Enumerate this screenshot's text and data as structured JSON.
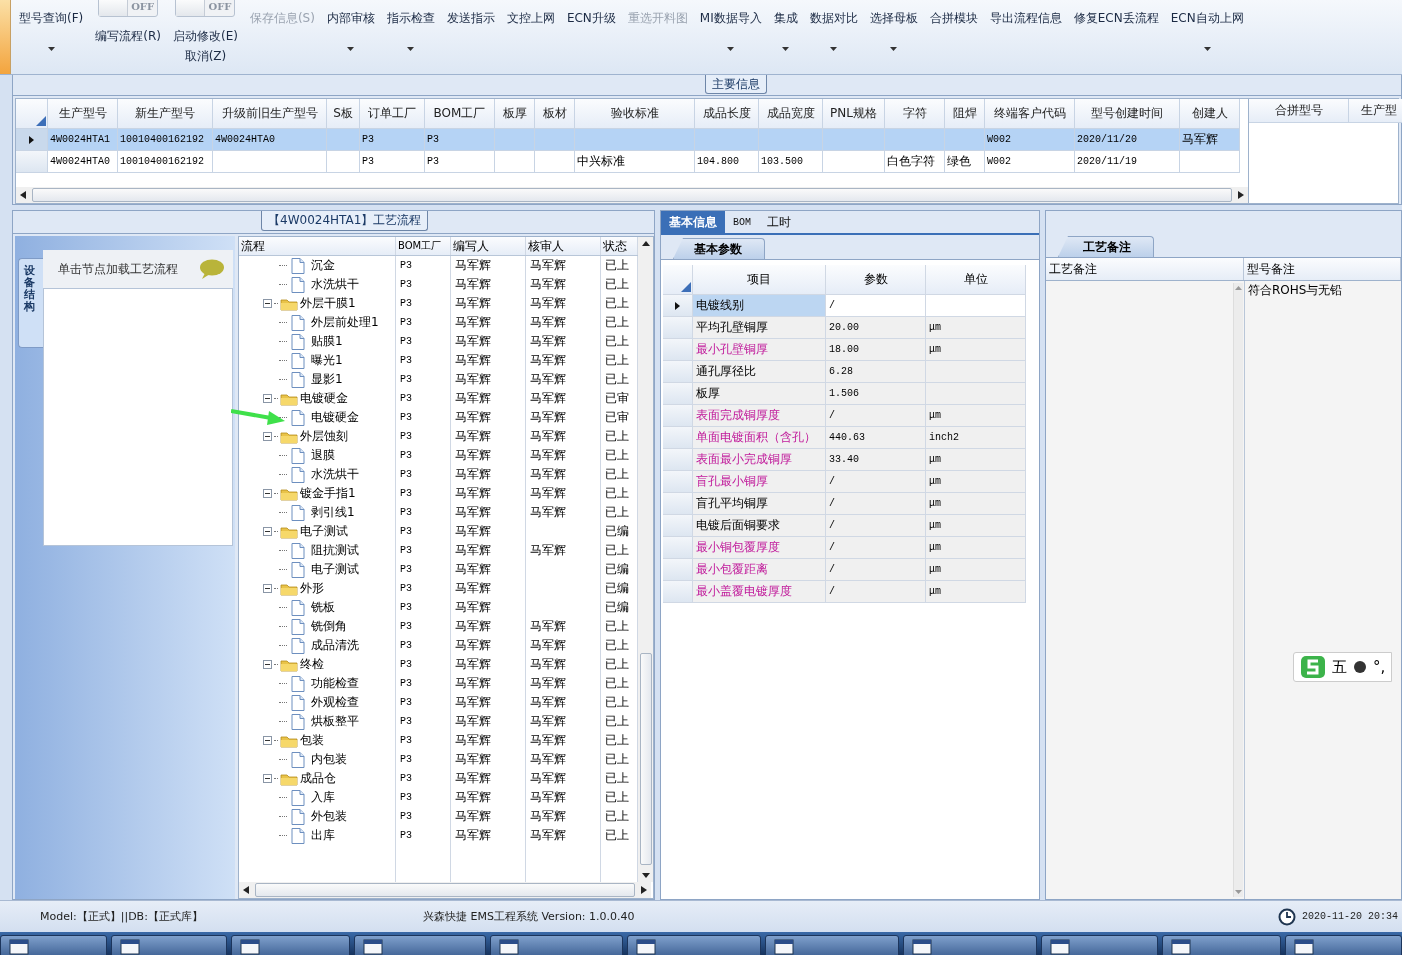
{
  "toolbar": {
    "items": [
      {
        "kind": "button",
        "label": "型号查询(F)",
        "dropdown": true,
        "disabled": false
      },
      {
        "kind": "toggle",
        "switch": "OFF",
        "on": false,
        "label": "编写流程(R)"
      },
      {
        "kind": "toggle",
        "switch": "OFF",
        "on": false,
        "label": "启动修改(E)",
        "sub": "取消(Z)"
      },
      {
        "kind": "button",
        "label": "保存信息(S)",
        "dropdown": false,
        "disabled": true
      },
      {
        "kind": "button",
        "label": "内部审核",
        "dropdown": true,
        "disabled": false
      },
      {
        "kind": "button",
        "label": "指示检查",
        "dropdown": true,
        "disabled": false
      },
      {
        "kind": "button",
        "label": "发送指示",
        "dropdown": false,
        "disabled": false
      },
      {
        "kind": "button",
        "label": "文控上网",
        "dropdown": false,
        "disabled": false
      },
      {
        "kind": "button",
        "label": "ECN升级",
        "dropdown": false,
        "disabled": false
      },
      {
        "kind": "button",
        "label": "重选开料图",
        "dropdown": false,
        "disabled": true
      },
      {
        "kind": "button",
        "label": "MI数据导入",
        "dropdown": true,
        "disabled": false
      },
      {
        "kind": "button",
        "label": "集成",
        "dropdown": true,
        "disabled": false
      },
      {
        "kind": "button",
        "label": "数据对比",
        "dropdown": true,
        "disabled": false
      },
      {
        "kind": "button",
        "label": "选择母板",
        "dropdown": true,
        "disabled": false
      },
      {
        "kind": "button",
        "label": "合拼模块",
        "dropdown": false,
        "disabled": false
      },
      {
        "kind": "button",
        "label": "导出流程信息",
        "dropdown": false,
        "disabled": false
      },
      {
        "kind": "button",
        "label": "修复ECN丢流程",
        "dropdown": false,
        "disabled": false
      },
      {
        "kind": "button",
        "label": "ECN自动上网",
        "dropdown": true,
        "disabled": false
      }
    ]
  },
  "main_info": {
    "title": "主要信息",
    "table": {
      "columns": [
        "生产型号",
        "新生产型号",
        "升级前旧生产型号",
        "S板",
        "订单工厂",
        "BOM工厂",
        "板厚",
        "板材",
        "验收标准",
        "成品长度",
        "成品宽度",
        "PNL规格",
        "字符",
        "阻焊",
        "终端客户代码",
        "型号创建时间",
        "创建人"
      ],
      "rows": [
        {
          "selected": true,
          "cells": [
            "4W0024HTA1",
            "10010400162192",
            "4W0024HTA0",
            null,
            "P3",
            "P3",
            null,
            null,
            null,
            null,
            null,
            null,
            null,
            null,
            "W002",
            "2020/11/20",
            "马军辉"
          ]
        },
        {
          "selected": false,
          "cells": [
            "4W0024HTA0",
            "10010400162192",
            null,
            null,
            "P3",
            "P3",
            null,
            null,
            "中兴标准",
            "104.800",
            "103.500",
            null,
            "白色字符",
            "绿色",
            "W002",
            "2020/11/19",
            null
          ]
        }
      ]
    },
    "side_table": {
      "columns": [
        "合拼型号",
        "生产型"
      ]
    }
  },
  "flow_panel": {
    "title": "【4W0024HTA1】工艺流程",
    "side_tab": "设备结构",
    "hint": "单击节点加载工艺流程",
    "tree": {
      "columns": [
        "流程",
        "BOM工厂",
        "编写人",
        "核审人",
        "状态"
      ],
      "nodes": [
        {
          "kind": "leaf",
          "cells": [
            "沉金",
            "P3",
            "马军辉",
            "马军辉",
            "已上"
          ]
        },
        {
          "kind": "leaf",
          "cells": [
            "水洗烘干",
            "P3",
            "马军辉",
            "马军辉",
            "已上"
          ]
        },
        {
          "kind": "folder",
          "expanded": true,
          "cells": [
            "外层干膜1",
            "P3",
            "马军辉",
            "马军辉",
            "已上"
          ],
          "children": [
            {
              "kind": "leaf",
              "cells": [
                "外层前处理1",
                "P3",
                "马军辉",
                "马军辉",
                "已上"
              ]
            },
            {
              "kind": "leaf",
              "cells": [
                "贴膜1",
                "P3",
                "马军辉",
                "马军辉",
                "已上"
              ]
            },
            {
              "kind": "leaf",
              "cells": [
                "曝光1",
                "P3",
                "马军辉",
                "马军辉",
                "已上"
              ]
            },
            {
              "kind": "leaf",
              "cells": [
                "显影1",
                "P3",
                "马军辉",
                "马军辉",
                "已上"
              ]
            }
          ]
        },
        {
          "kind": "folder",
          "expanded": true,
          "cells": [
            "电镀硬金",
            "P3",
            "马军辉",
            "马军辉",
            "已审"
          ],
          "children": [
            {
              "kind": "leaf",
              "cells": [
                "电镀硬金",
                "P3",
                "马军辉",
                "马军辉",
                "已审"
              ]
            }
          ]
        },
        {
          "kind": "folder",
          "expanded": true,
          "cells": [
            "外层蚀刻",
            "P3",
            "马军辉",
            "马军辉",
            "已上"
          ],
          "children": [
            {
              "kind": "leaf",
              "cells": [
                "退膜",
                "P3",
                "马军辉",
                "马军辉",
                "已上"
              ]
            },
            {
              "kind": "leaf",
              "cells": [
                "水洗烘干",
                "P3",
                "马军辉",
                "马军辉",
                "已上"
              ]
            }
          ]
        },
        {
          "kind": "folder",
          "expanded": true,
          "cells": [
            "镀金手指1",
            "P3",
            "马军辉",
            "马军辉",
            "已上"
          ],
          "children": [
            {
              "kind": "leaf",
              "cells": [
                "剥引线1",
                "P3",
                "马军辉",
                "马军辉",
                "已上"
              ]
            }
          ]
        },
        {
          "kind": "folder",
          "expanded": true,
          "cells": [
            "电子测试",
            "P3",
            "马军辉",
            null,
            "已编"
          ],
          "children": [
            {
              "kind": "leaf",
              "cells": [
                "阻抗测试",
                "P3",
                "马军辉",
                "马军辉",
                "已上"
              ]
            },
            {
              "kind": "leaf",
              "cells": [
                "电子测试",
                "P3",
                "马军辉",
                null,
                "已编"
              ]
            }
          ]
        },
        {
          "kind": "folder",
          "expanded": true,
          "cells": [
            "外形",
            "P3",
            "马军辉",
            null,
            "已编"
          ],
          "children": [
            {
              "kind": "leaf",
              "cells": [
                "铣板",
                "P3",
                "马军辉",
                null,
                "已编"
              ]
            },
            {
              "kind": "leaf",
              "cells": [
                "铣倒角",
                "P3",
                "马军辉",
                "马军辉",
                "已上"
              ]
            },
            {
              "kind": "leaf",
              "cells": [
                "成品清洗",
                "P3",
                "马军辉",
                "马军辉",
                "已上"
              ]
            }
          ]
        },
        {
          "kind": "folder",
          "expanded": true,
          "cells": [
            "终检",
            "P3",
            "马军辉",
            "马军辉",
            "已上"
          ],
          "children": [
            {
              "kind": "leaf",
              "cells": [
                "功能检查",
                "P3",
                "马军辉",
                "马军辉",
                "已上"
              ]
            },
            {
              "kind": "leaf",
              "cells": [
                "外观检查",
                "P3",
                "马军辉",
                "马军辉",
                "已上"
              ]
            },
            {
              "kind": "leaf",
              "cells": [
                "烘板整平",
                "P3",
                "马军辉",
                "马军辉",
                "已上"
              ]
            }
          ]
        },
        {
          "kind": "folder",
          "expanded": true,
          "cells": [
            "包装",
            "P3",
            "马军辉",
            "马军辉",
            "已上"
          ],
          "children": [
            {
              "kind": "leaf",
              "cells": [
                "内包装",
                "P3",
                "马军辉",
                "马军辉",
                "已上"
              ]
            }
          ]
        },
        {
          "kind": "folder",
          "expanded": true,
          "cells": [
            "成品仓",
            "P3",
            "马军辉",
            "马军辉",
            "已上"
          ],
          "children": [
            {
              "kind": "leaf",
              "cells": [
                "入库",
                "P3",
                "马军辉",
                "马军辉",
                "已上"
              ]
            },
            {
              "kind": "leaf",
              "cells": [
                "外包装",
                "P3",
                "马军辉",
                "马军辉",
                "已上"
              ]
            },
            {
              "kind": "leaf",
              "cells": [
                "出库",
                "P3",
                "马军辉",
                "马军辉",
                "已上"
              ]
            }
          ]
        }
      ]
    }
  },
  "info_panel": {
    "tabs": [
      {
        "label": "基本信息",
        "selected": true
      },
      {
        "label": "BOM",
        "selected": false
      },
      {
        "label": "工时",
        "selected": false
      }
    ],
    "sub_tab": "基本参数",
    "table": {
      "columns": [
        "项目",
        "参数",
        "单位"
      ],
      "rows": [
        {
          "selected": true,
          "highlighted": false,
          "cells": [
            "电镀线别",
            "/",
            null
          ]
        },
        {
          "selected": false,
          "highlighted": false,
          "cells": [
            "平均孔壁铜厚",
            "20.00",
            "μm"
          ]
        },
        {
          "selected": false,
          "highlighted": true,
          "cells": [
            "最小孔壁铜厚",
            "18.00",
            "μm"
          ]
        },
        {
          "selected": false,
          "highlighted": false,
          "cells": [
            "通孔厚径比",
            "6.28",
            null
          ]
        },
        {
          "selected": false,
          "highlighted": false,
          "cells": [
            "板厚",
            "1.506",
            null
          ]
        },
        {
          "selected": false,
          "highlighted": true,
          "cells": [
            "表面完成铜厚度",
            "/",
            "μm"
          ]
        },
        {
          "selected": false,
          "highlighted": true,
          "cells": [
            "单面电镀面积（含孔）",
            "440.63",
            "inch2"
          ]
        },
        {
          "selected": false,
          "highlighted": true,
          "cells": [
            "表面最小完成铜厚",
            "33.40",
            "μm"
          ]
        },
        {
          "selected": false,
          "highlighted": true,
          "cells": [
            "盲孔最小铜厚",
            "/",
            "μm"
          ]
        },
        {
          "selected": false,
          "highlighted": false,
          "cells": [
            "盲孔平均铜厚",
            "/",
            "μm"
          ]
        },
        {
          "selected": false,
          "highlighted": false,
          "cells": [
            "电镀后面铜要求",
            "/",
            "μm"
          ]
        },
        {
          "selected": false,
          "highlighted": true,
          "cells": [
            "最小铜包覆厚度",
            "/",
            "μm"
          ]
        },
        {
          "selected": false,
          "highlighted": true,
          "cells": [
            "最小包覆距离",
            "/",
            "μm"
          ]
        },
        {
          "selected": false,
          "highlighted": true,
          "cells": [
            "最小盖覆电镀厚度",
            "/",
            "μm"
          ]
        }
      ]
    }
  },
  "remark_panel": {
    "tab": "工艺备注",
    "columns": [
      "工艺备注",
      "型号备注"
    ],
    "rows": [
      [
        null,
        "符合ROHS与无铅"
      ]
    ]
  },
  "ime_bar": {
    "mode": "五",
    "punct": "°,"
  },
  "status_bar": {
    "left": "Model:【正式】||DB:【正式库】",
    "center": "兴森快捷 EMS工程系统 Version: 1.0.0.40",
    "time": "2020-11-20 20:34"
  }
}
